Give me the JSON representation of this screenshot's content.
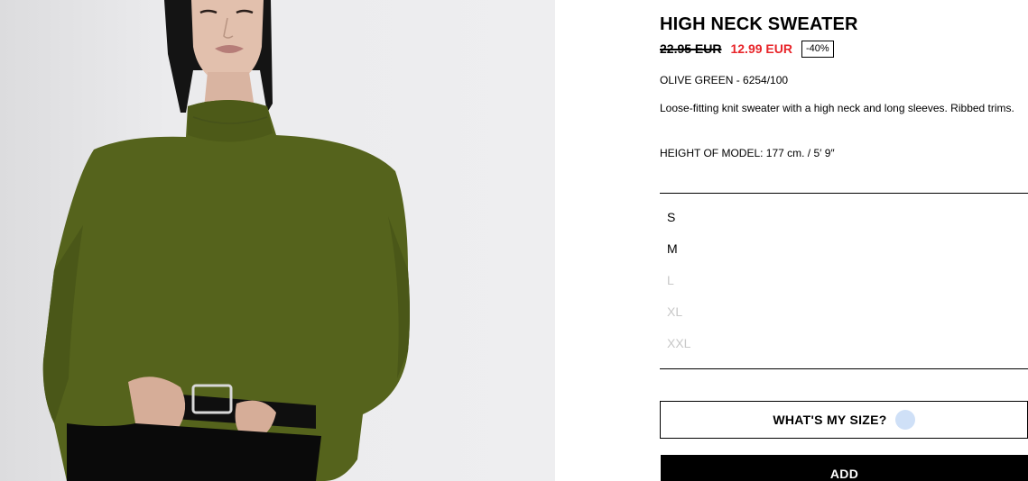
{
  "product": {
    "title": "HIGH NECK SWEATER",
    "old_price": "22.95 EUR",
    "new_price": "12.99 EUR",
    "discount": "-40%",
    "color_ref": "OLIVE GREEN - 6254/100",
    "description": "Loose-fitting knit sweater with a high neck and long sleeves. Ribbed trims.",
    "model_height": "HEIGHT OF MODEL: 177 cm. / 5′ 9″"
  },
  "sizes": [
    {
      "label": "S",
      "available": true
    },
    {
      "label": "M",
      "available": true
    },
    {
      "label": "L",
      "available": false
    },
    {
      "label": "XL",
      "available": false
    },
    {
      "label": "XXL",
      "available": false
    }
  ],
  "actions": {
    "size_guide_label": "WHAT'S MY SIZE?",
    "add_label": "ADD"
  },
  "colors": {
    "sale_price": "#e8252a",
    "sweater": "#55631c",
    "unavailable_size": "#c8c8c8",
    "size_guide_dot": "#cfe0f7"
  }
}
